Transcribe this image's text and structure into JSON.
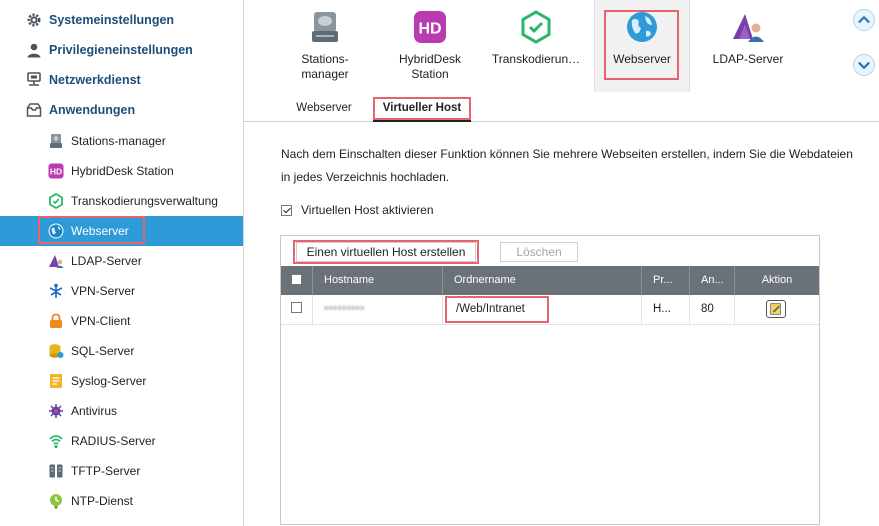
{
  "sidebar": {
    "top_items": [
      {
        "label": "Systemeinstellungen",
        "icon": "gear-icon"
      },
      {
        "label": "Privilegieneinstellungen",
        "icon": "user-icon"
      },
      {
        "label": "Netzwerkdienst",
        "icon": "network-icon"
      },
      {
        "label": "Anwendungen",
        "icon": "applications-icon"
      }
    ],
    "sub_items": [
      {
        "label": "Stations-manager",
        "icon": "stations-manager-icon"
      },
      {
        "label": "HybridDesk Station",
        "icon": "hybriddesk-icon"
      },
      {
        "label": "Transkodierungsverwaltung",
        "icon": "transcode-icon"
      },
      {
        "label": "Webserver",
        "icon": "globe-icon",
        "active": true
      },
      {
        "label": "LDAP-Server",
        "icon": "ldap-icon"
      },
      {
        "label": "VPN-Server",
        "icon": "vpn-server-icon"
      },
      {
        "label": "VPN-Client",
        "icon": "vpn-client-icon"
      },
      {
        "label": "SQL-Server",
        "icon": "sql-icon"
      },
      {
        "label": "Syslog-Server",
        "icon": "syslog-icon"
      },
      {
        "label": "Antivirus",
        "icon": "antivirus-icon"
      },
      {
        "label": "RADIUS-Server",
        "icon": "radius-icon"
      },
      {
        "label": "TFTP-Server",
        "icon": "tftp-icon"
      },
      {
        "label": "NTP-Dienst",
        "icon": "ntp-icon"
      }
    ]
  },
  "apps": [
    {
      "label": "Stations-\nmanager",
      "icon": "stations-manager-icon"
    },
    {
      "label": "HybridDesk\nStation",
      "icon": "hybriddesk-icon",
      "icon_text": "HD"
    },
    {
      "label": "Transkodierun…",
      "icon": "transcode-icon"
    },
    {
      "label": "Webserver",
      "icon": "globe-icon",
      "selected": true
    },
    {
      "label": "LDAP-Server",
      "icon": "ldap-icon"
    }
  ],
  "nav": {
    "up_icon": "chevron-up-icon",
    "down_icon": "chevron-down-icon"
  },
  "tabs": [
    {
      "label": "Webserver"
    },
    {
      "label": "Virtueller Host",
      "active": true
    }
  ],
  "content": {
    "description_line1": "Nach dem Einschalten dieser Funktion können Sie mehrere Webseiten erstellen, indem Sie die Webdateien",
    "description_line2": "in jedes Verzeichnis hochladen.",
    "enable_label": "Virtuellen Host aktivieren",
    "enable_checked": true
  },
  "toolbar": {
    "create_label": "Einen virtuellen Host erstellen",
    "delete_label": "Löschen"
  },
  "table": {
    "headers": [
      "Hostname",
      "Ordnername",
      "Pr...",
      "An...",
      "Aktion"
    ],
    "rows": [
      {
        "hostname": "•••••••••",
        "folder": "/Web/Intranet",
        "protocol": "H...",
        "port": "80",
        "action_icon": "edit-icon"
      }
    ]
  },
  "colors": {
    "accent": "#2e9bd8",
    "highlight": "#e8636b",
    "sidebar_heading": "#1d4f7a",
    "table_header": "#6b7179"
  }
}
